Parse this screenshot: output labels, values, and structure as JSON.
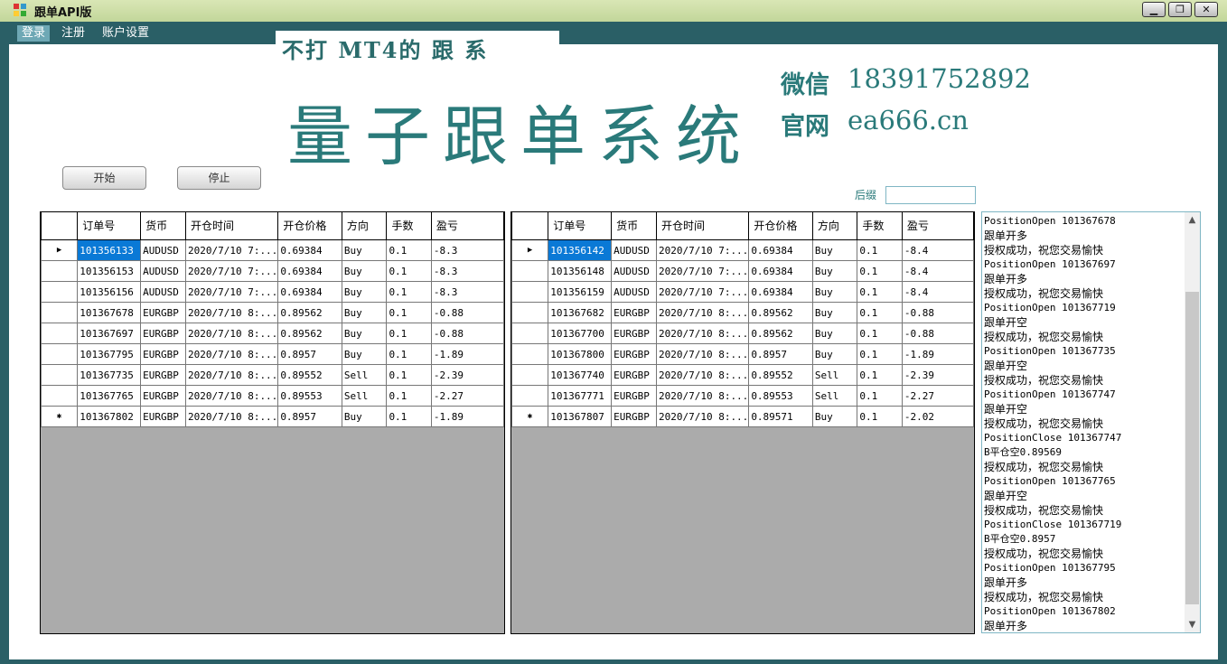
{
  "window": {
    "title": "跟单API版",
    "minimize": "▁",
    "maximize": "❐",
    "close": "✕"
  },
  "menu": [
    "登录",
    "注册",
    "账户设置"
  ],
  "banner": {
    "tagline": "不打  MT4的 跟  系",
    "big_title": "量子跟单系统",
    "wechat_label": "微信",
    "wechat_value": "18391752892",
    "site_label": "官网",
    "site_value": "ea666.cn"
  },
  "buttons": {
    "start": "开始",
    "stop": "停止"
  },
  "suffix": {
    "label": "后缀",
    "value": ""
  },
  "columns": [
    "订单号",
    "货币",
    "开仓时间",
    "开仓价格",
    "方向",
    "手数",
    "盈亏"
  ],
  "grid_left": {
    "rows": [
      [
        "101356133",
        "AUDUSD",
        "2020/7/10 7:...",
        "0.69384",
        "Buy",
        "0.1",
        "-8.3"
      ],
      [
        "101356153",
        "AUDUSD",
        "2020/7/10 7:...",
        "0.69384",
        "Buy",
        "0.1",
        "-8.3"
      ],
      [
        "101356156",
        "AUDUSD",
        "2020/7/10 7:...",
        "0.69384",
        "Buy",
        "0.1",
        "-8.3"
      ],
      [
        "101367678",
        "EURGBP",
        "2020/7/10 8:...",
        "0.89562",
        "Buy",
        "0.1",
        "-0.88"
      ],
      [
        "101367697",
        "EURGBP",
        "2020/7/10 8:...",
        "0.89562",
        "Buy",
        "0.1",
        "-0.88"
      ],
      [
        "101367795",
        "EURGBP",
        "2020/7/10 8:...",
        "0.8957",
        "Buy",
        "0.1",
        "-1.89"
      ],
      [
        "101367735",
        "EURGBP",
        "2020/7/10 8:...",
        "0.89552",
        "Sell",
        "0.1",
        "-2.39"
      ],
      [
        "101367765",
        "EURGBP",
        "2020/7/10 8:...",
        "0.89553",
        "Sell",
        "0.1",
        "-2.27"
      ],
      [
        "101367802",
        "EURGBP",
        "2020/7/10 8:...",
        "0.8957",
        "Buy",
        "0.1",
        "-1.89"
      ]
    ]
  },
  "grid_right": {
    "rows": [
      [
        "101356142",
        "AUDUSD",
        "2020/7/10 7:...",
        "0.69384",
        "Buy",
        "0.1",
        "-8.4"
      ],
      [
        "101356148",
        "AUDUSD",
        "2020/7/10 7:...",
        "0.69384",
        "Buy",
        "0.1",
        "-8.4"
      ],
      [
        "101356159",
        "AUDUSD",
        "2020/7/10 7:...",
        "0.69384",
        "Buy",
        "0.1",
        "-8.4"
      ],
      [
        "101367682",
        "EURGBP",
        "2020/7/10 8:...",
        "0.89562",
        "Buy",
        "0.1",
        "-0.88"
      ],
      [
        "101367700",
        "EURGBP",
        "2020/7/10 8:...",
        "0.89562",
        "Buy",
        "0.1",
        "-0.88"
      ],
      [
        "101367800",
        "EURGBP",
        "2020/7/10 8:...",
        "0.8957",
        "Buy",
        "0.1",
        "-1.89"
      ],
      [
        "101367740",
        "EURGBP",
        "2020/7/10 8:...",
        "0.89552",
        "Sell",
        "0.1",
        "-2.39"
      ],
      [
        "101367771",
        "EURGBP",
        "2020/7/10 8:...",
        "0.89553",
        "Sell",
        "0.1",
        "-2.27"
      ],
      [
        "101367807",
        "EURGBP",
        "2020/7/10 8:...",
        "0.89571",
        "Buy",
        "0.1",
        "-2.02"
      ]
    ]
  },
  "row_markers": {
    "current": "▶",
    "new": "✱"
  },
  "log": [
    "PositionOpen 101367678",
    "跟单开多",
    "授权成功，祝您交易愉快",
    "PositionOpen 101367697",
    "跟单开多",
    "授权成功，祝您交易愉快",
    "PositionOpen 101367719",
    "跟单开空",
    "授权成功，祝您交易愉快",
    "PositionOpen 101367735",
    "跟单开空",
    "授权成功，祝您交易愉快",
    "PositionOpen 101367747",
    "跟单开空",
    "授权成功，祝您交易愉快",
    "PositionClose 101367747",
    "B平仓空0.89569",
    "授权成功，祝您交易愉快",
    "PositionOpen 101367765",
    "跟单开空",
    "授权成功，祝您交易愉快",
    "PositionClose 101367719",
    "B平仓空0.8957",
    "授权成功，祝您交易愉快",
    "PositionOpen 101367795",
    "跟单开多",
    "授权成功，祝您交易愉快",
    "PositionOpen 101367802",
    "跟单开多"
  ],
  "scroll": {
    "up": "▲",
    "down": "▼"
  },
  "colors": {
    "frame": "#2a5f66",
    "accent": "#2a7a7a",
    "selected": "#0a79d6"
  }
}
